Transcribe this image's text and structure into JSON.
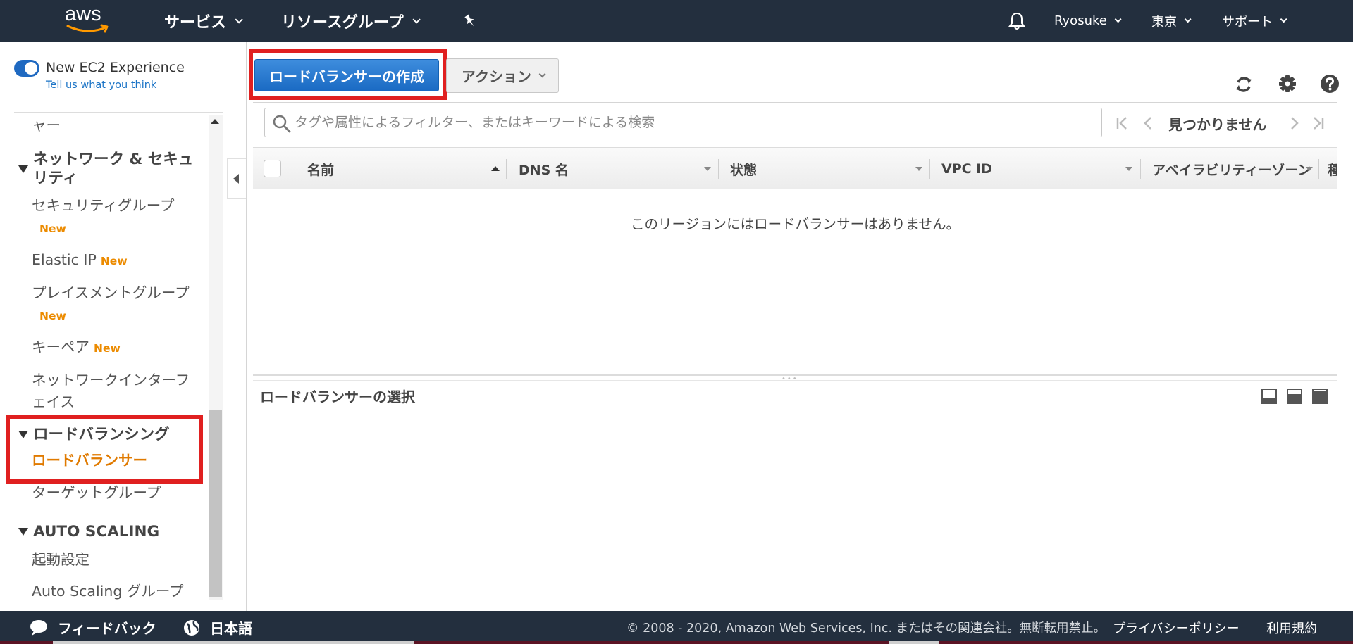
{
  "topnav": {
    "logo_text": "aws",
    "services": "サービス",
    "resource_groups": "リソースグループ",
    "user": "Ryosuke",
    "region": "東京",
    "support": "サポート"
  },
  "sidebar": {
    "experience_label": "New EC2 Experience",
    "tell_us": "Tell us what you think",
    "partial_item": "ャー",
    "network_section": "ネットワーク & セキュリティ",
    "network_section_line1": "ネットワーク & セキュ",
    "network_section_line2": "リティ",
    "security_groups": "セキュリティグループ",
    "elastic_ip": "Elastic IP",
    "placement_groups": "プレイスメントグループ",
    "key_pairs": "キーペア",
    "network_interfaces_line1": "ネットワークインターフ",
    "network_interfaces_line2": "ェイス",
    "new_badge": "New",
    "load_balancing_section": "ロードバランシング",
    "load_balancers": "ロードバランサー",
    "target_groups": "ターゲットグループ",
    "auto_scaling_section": "AUTO SCALING",
    "launch_configs": "起動設定",
    "auto_scaling_groups": "Auto Scaling グループ"
  },
  "toolbar": {
    "create_label": "ロードバランサーの作成",
    "actions_label": "アクション"
  },
  "search": {
    "placeholder": "タグや属性によるフィルター、またはキーワードによる検索"
  },
  "pagination": {
    "status": "見つかりません"
  },
  "table": {
    "columns": [
      "名前",
      "DNS 名",
      "状態",
      "VPC ID",
      "アベイラビリティーゾーン",
      "種"
    ],
    "empty_message": "このリージョンにはロードバランサーはありません。"
  },
  "detail": {
    "title": "ロードバランサーの選択"
  },
  "footer": {
    "feedback": "フィードバック",
    "language": "日本語",
    "copyright": "© 2008 - 2020, Amazon Web Services, Inc. またはその関連会社。無断転用禁止。",
    "privacy": "プライバシーポリシー",
    "terms": "利用規約"
  },
  "colors": {
    "nav_bg": "#232f3e",
    "primary_button": "#1f69c1",
    "new_badge": "#ec8b00",
    "active_item": "#e07a00",
    "highlight_box": "#e02020"
  }
}
